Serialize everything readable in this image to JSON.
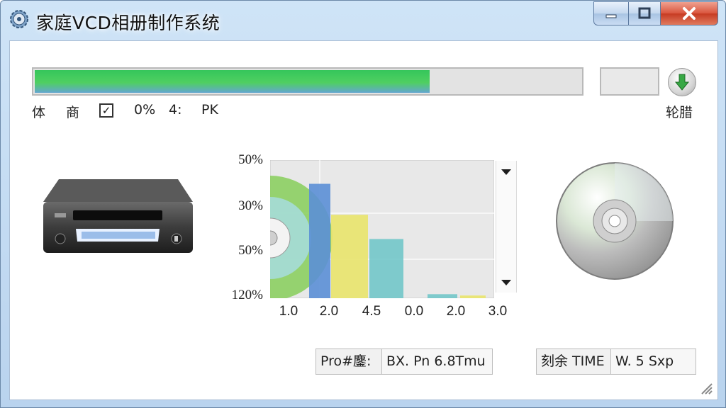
{
  "window": {
    "title": "家庭VCD相册制作系统",
    "controls": {
      "minimize": "minimize",
      "maximize": "maximize",
      "close": "close"
    }
  },
  "progress": {
    "value_fraction": 0.72,
    "fill_color": "#3cc95e",
    "download_button_label": "轮腊"
  },
  "status_row": {
    "item1": "体",
    "item2": "商",
    "check_mark": "✓",
    "item3": "0%",
    "item4": "4:",
    "item5": "PK"
  },
  "chart_data": {
    "type": "bar",
    "y_tick_labels": [
      "50%",
      "30%",
      "50%",
      "120%"
    ],
    "x_tick_labels": [
      "1.0",
      "2.0",
      "4.5",
      "0.0",
      "2.0",
      "3.0"
    ],
    "categories": [
      "1.0",
      "2.0",
      "4.5",
      "0.0",
      "2.0",
      "3.0"
    ],
    "bars": [
      {
        "category": "2.0",
        "value_fraction": 0.85,
        "color": "#5b8fd6"
      },
      {
        "category": "4.5",
        "value_fraction": 0.62,
        "color": "#e9e46c"
      },
      {
        "category": "0.0",
        "value_fraction": 0.44,
        "color": "#72c6c9"
      },
      {
        "category": "2.0",
        "value_fraction": 0.03,
        "color": "#72c6c9"
      },
      {
        "category": "3.0",
        "value_fraction": 0.02,
        "color": "#e9e46c"
      }
    ],
    "grid": true,
    "background": "#e8e8e8"
  },
  "icons": {
    "app": "gear-disc-icon",
    "recorder": "vcd-recorder-icon",
    "disc": "cd-disc-icon",
    "download": "download-arrow-icon"
  },
  "footer": {
    "progress_label": "Pro#鏖:",
    "progress_value": "BX. Pn 6.8Tmu",
    "time_label": "刻余 TIME",
    "time_value": "W. 5 Sxp"
  }
}
